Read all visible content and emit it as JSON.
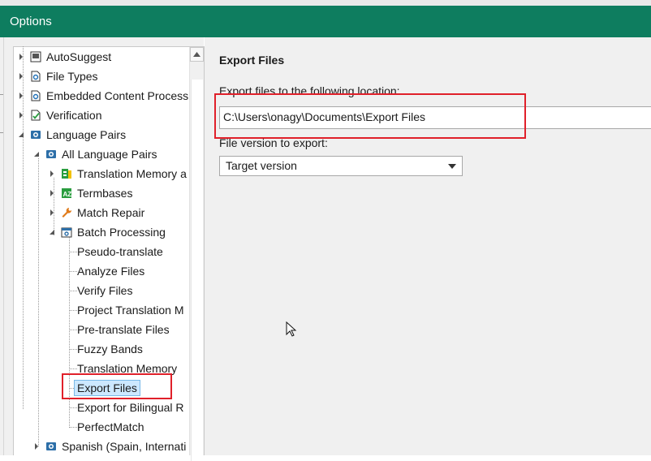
{
  "window": {
    "title": "Options"
  },
  "tree": {
    "items": [
      {
        "label": "AutoSuggest"
      },
      {
        "label": "File Types"
      },
      {
        "label": "Embedded Content Process"
      },
      {
        "label": "Verification"
      },
      {
        "label": "Language Pairs"
      },
      {
        "label": "All Language Pairs"
      },
      {
        "label": "Translation Memory a"
      },
      {
        "label": "Termbases"
      },
      {
        "label": "Match Repair"
      },
      {
        "label": "Batch Processing"
      },
      {
        "label": "Pseudo-translate"
      },
      {
        "label": "Analyze Files"
      },
      {
        "label": "Verify Files"
      },
      {
        "label": "Project Translation M"
      },
      {
        "label": "Pre-translate Files"
      },
      {
        "label": "Fuzzy Bands"
      },
      {
        "label": "Translation Memory"
      },
      {
        "label": "Export Files"
      },
      {
        "label": "Export for Bilingual R"
      },
      {
        "label": "PerfectMatch"
      },
      {
        "label": "Spanish (Spain, Internati"
      }
    ],
    "selected_index": 17
  },
  "panel": {
    "title": "Export Files",
    "location_label": "Export files to the following location:",
    "location_value": "C:\\Users\\onagy\\Documents\\Export Files",
    "version_label": "File version to export:",
    "version_value": "Target version"
  },
  "colors": {
    "titlebar": "#0e7d5f",
    "highlight_box": "#e0202a",
    "selection_fill": "#cce8ff"
  }
}
